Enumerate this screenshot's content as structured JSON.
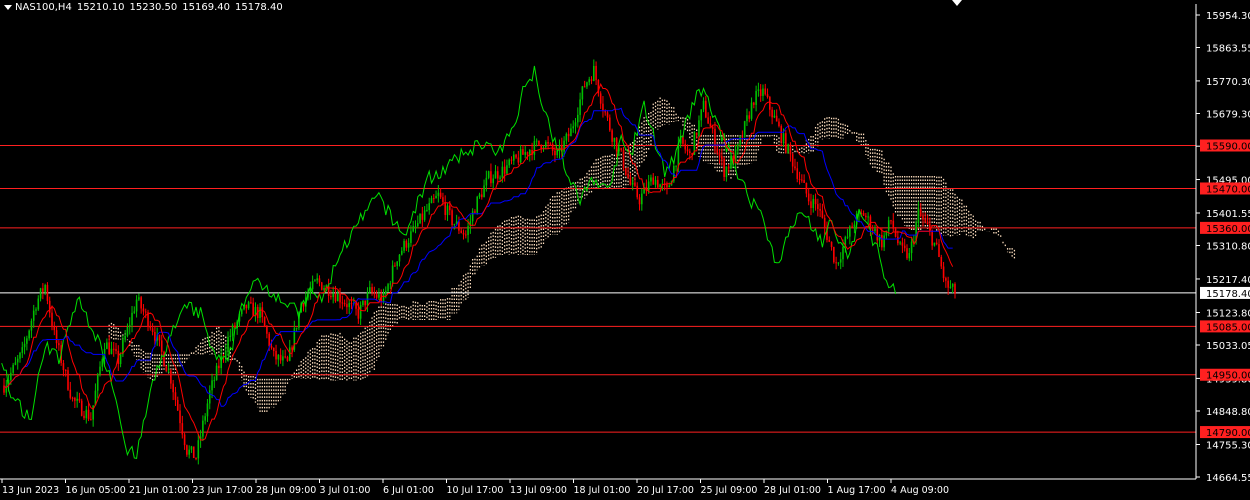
{
  "header": {
    "symbol": "NAS100,H4",
    "open": "15210.10",
    "high": "15230.50",
    "low": "15169.40",
    "close": "15178.40"
  },
  "colors": {
    "background": "#000000",
    "axis": "#ffffff",
    "bull": "#00c000",
    "bear": "#ff0000",
    "tenkan": "#ff0000",
    "kijun": "#0000ff",
    "chikou": "#00e000",
    "cloud": "#ffe0c0",
    "level_line": "#ff2020",
    "price_line": "#ffffff"
  },
  "chart_data": {
    "type": "candlestick",
    "y_range": [
      14664.55,
      15954.3
    ],
    "price_ticks": [
      "15954.30",
      "15863.55",
      "15770.30",
      "15679.30",
      "15588.05",
      "15495.00",
      "15401.55",
      "15310.80",
      "15217.40",
      "15123.80",
      "15033.05",
      "14939.80",
      "14848.80",
      "14755.30",
      "14664.55"
    ],
    "time_ticks": [
      "13 Jun 2023",
      "16 Jun 05:00",
      "21 Jun 01:00",
      "23 Jun 17:00",
      "28 Jun 09:00",
      "3 Jul 01:00",
      "6 Jul 01:00",
      "10 Jul 17:00",
      "13 Jul 09:00",
      "18 Jul 01:00",
      "20 Jul 17:00",
      "25 Jul 09:00",
      "28 Jul 01:00",
      "1 Aug 17:00",
      "4 Aug 09:00"
    ],
    "levels": [
      {
        "value": 15590.0,
        "label": "15590.00"
      },
      {
        "value": 15470.0,
        "label": "15470.00"
      },
      {
        "value": 15360.0,
        "label": "15360.00"
      },
      {
        "value": 15085.0,
        "label": "15085.00"
      },
      {
        "value": 14950.0,
        "label": "14950.00"
      },
      {
        "value": 14790.0,
        "label": "14790.00"
      }
    ],
    "last_price": {
      "value": 15178.4,
      "label": "15178.40"
    },
    "path_points": [
      [
        0,
        14920
      ],
      [
        8,
        15010
      ],
      [
        14,
        15150
      ],
      [
        18,
        15200
      ],
      [
        22,
        15060
      ],
      [
        30,
        14880
      ],
      [
        38,
        14830
      ],
      [
        44,
        15040
      ],
      [
        50,
        14990
      ],
      [
        58,
        15160
      ],
      [
        65,
        15080
      ],
      [
        73,
        14940
      ],
      [
        80,
        14740
      ],
      [
        84,
        14720
      ],
      [
        90,
        14900
      ],
      [
        98,
        15050
      ],
      [
        106,
        15140
      ],
      [
        112,
        15120
      ],
      [
        118,
        15000
      ],
      [
        124,
        14980
      ],
      [
        130,
        15150
      ],
      [
        137,
        15210
      ],
      [
        142,
        15190
      ],
      [
        148,
        15160
      ],
      [
        155,
        15120
      ],
      [
        160,
        15180
      ],
      [
        166,
        15160
      ],
      [
        172,
        15280
      ],
      [
        178,
        15340
      ],
      [
        184,
        15400
      ],
      [
        190,
        15450
      ],
      [
        196,
        15380
      ],
      [
        202,
        15340
      ],
      [
        206,
        15420
      ],
      [
        212,
        15500
      ],
      [
        218,
        15520
      ],
      [
        224,
        15550
      ],
      [
        230,
        15580
      ],
      [
        236,
        15600
      ],
      [
        242,
        15560
      ],
      [
        248,
        15630
      ],
      [
        254,
        15760
      ],
      [
        258,
        15800
      ],
      [
        262,
        15700
      ],
      [
        266,
        15620
      ],
      [
        270,
        15560
      ],
      [
        274,
        15480
      ],
      [
        278,
        15440
      ],
      [
        284,
        15500
      ],
      [
        290,
        15460
      ],
      [
        296,
        15600
      ],
      [
        300,
        15560
      ],
      [
        306,
        15700
      ],
      [
        310,
        15620
      ],
      [
        315,
        15520
      ],
      [
        320,
        15560
      ],
      [
        324,
        15640
      ],
      [
        328,
        15720
      ],
      [
        332,
        15740
      ],
      [
        336,
        15680
      ],
      [
        340,
        15620
      ],
      [
        344,
        15560
      ],
      [
        348,
        15500
      ],
      [
        352,
        15440
      ],
      [
        356,
        15420
      ],
      [
        360,
        15340
      ],
      [
        364,
        15260
      ],
      [
        368,
        15320
      ],
      [
        372,
        15380
      ],
      [
        376,
        15400
      ],
      [
        380,
        15360
      ],
      [
        384,
        15320
      ],
      [
        388,
        15380
      ],
      [
        392,
        15300
      ],
      [
        396,
        15280
      ],
      [
        400,
        15400
      ],
      [
        404,
        15360
      ],
      [
        408,
        15300
      ],
      [
        412,
        15200
      ],
      [
        416,
        15180
      ]
    ]
  }
}
